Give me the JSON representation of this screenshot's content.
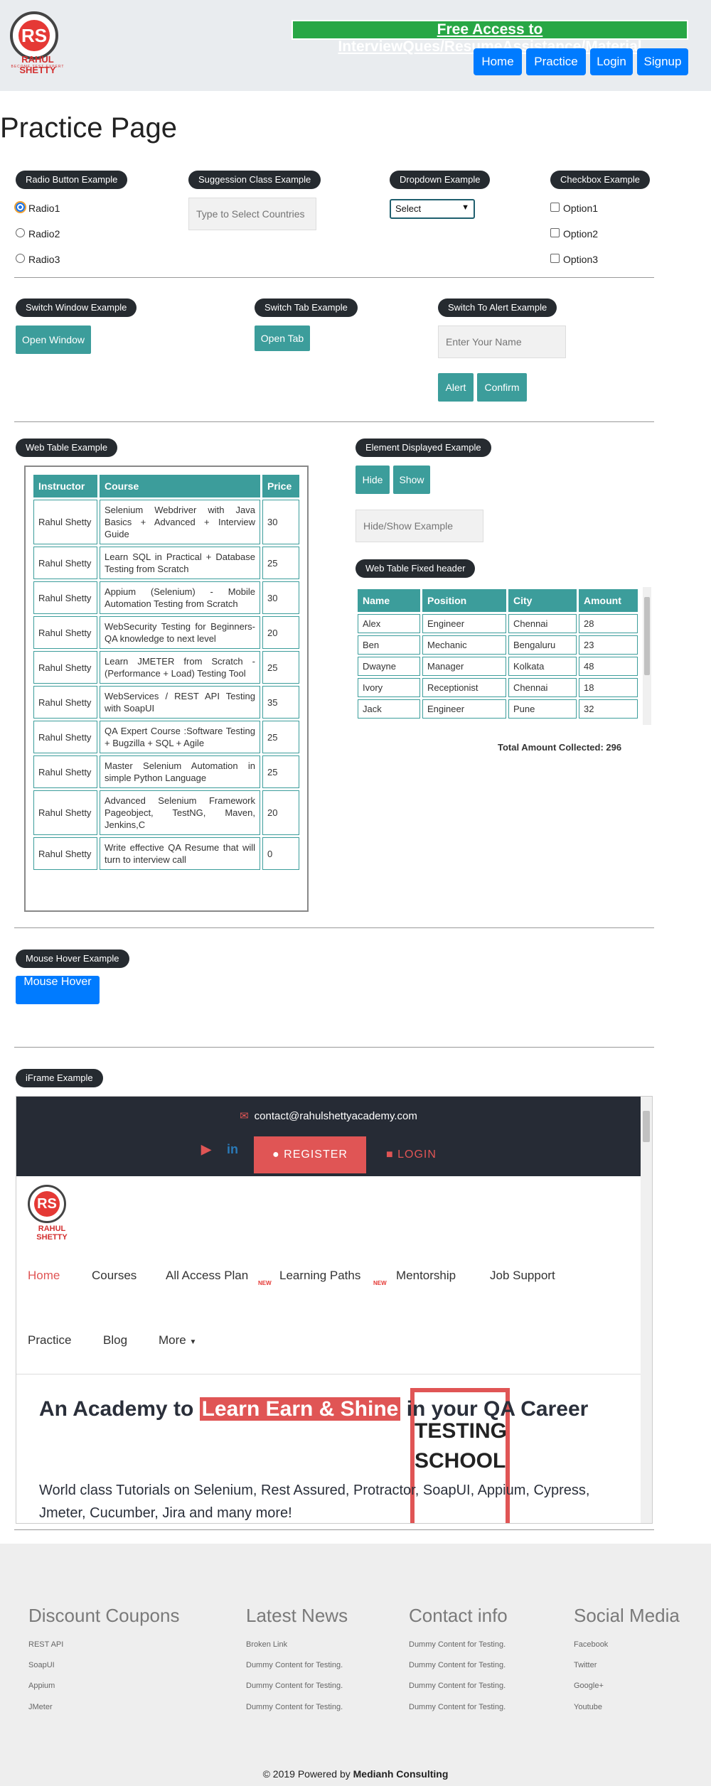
{
  "brand": {
    "name": "RAHUL SHETTY",
    "tagline": "BECOME TEST EXPERT",
    "logo_letters": "RS"
  },
  "header": {
    "free_access_link": "Free Access to InterviewQues/ResumeAssistance/Material",
    "nav": [
      "Home",
      "Practice",
      "Login",
      "Signup"
    ]
  },
  "page_title": "Practice Page",
  "radio_section": {
    "title": "Radio Button Example",
    "options": [
      "Radio1",
      "Radio2",
      "Radio3"
    ],
    "selected": "Radio1"
  },
  "suggestion_section": {
    "title": "Suggession Class Example",
    "placeholder": "Type to Select Countries"
  },
  "dropdown_section": {
    "title": "Dropdown Example",
    "selected": "Select"
  },
  "checkbox_section": {
    "title": "Checkbox Example",
    "options": [
      "Option1",
      "Option2",
      "Option3"
    ]
  },
  "switch_window": {
    "title": "Switch Window Example",
    "button": "Open Window"
  },
  "switch_tab": {
    "title": "Switch Tab Example",
    "button": "Open Tab"
  },
  "alert_section": {
    "title": "Switch To Alert Example",
    "placeholder": "Enter Your Name",
    "alert_button": "Alert",
    "confirm_button": "Confirm"
  },
  "web_table": {
    "title": "Web Table Example",
    "headers": [
      "Instructor",
      "Course",
      "Price"
    ],
    "rows": [
      [
        "Rahul Shetty",
        "Selenium Webdriver with Java Basics + Advanced + Interview Guide",
        "30"
      ],
      [
        "Rahul Shetty",
        "Learn SQL in Practical + Database Testing from Scratch",
        "25"
      ],
      [
        "Rahul Shetty",
        "Appium (Selenium) - Mobile Automation Testing from Scratch",
        "30"
      ],
      [
        "Rahul Shetty",
        "WebSecurity Testing for Beginners-QA knowledge to next level",
        "20"
      ],
      [
        "Rahul Shetty",
        "Learn JMETER from Scratch - (Performance + Load) Testing Tool",
        "25"
      ],
      [
        "Rahul Shetty",
        "WebServices / REST API Testing with SoapUI",
        "35"
      ],
      [
        "Rahul Shetty",
        "QA Expert Course :Software Testing + Bugzilla + SQL + Agile",
        "25"
      ],
      [
        "Rahul Shetty",
        "Master Selenium Automation in simple Python Language",
        "25"
      ],
      [
        "Rahul Shetty",
        "Advanced Selenium Framework Pageobject, TestNG, Maven, Jenkins,C",
        "20"
      ],
      [
        "Rahul Shetty",
        "Write effective QA Resume that will turn to interview call",
        "0"
      ]
    ]
  },
  "element_displayed": {
    "title": "Element Displayed Example",
    "hide_button": "Hide",
    "show_button": "Show",
    "placeholder": "Hide/Show Example"
  },
  "fixed_table": {
    "title": "Web Table Fixed header",
    "headers": [
      "Name",
      "Position",
      "City",
      "Amount"
    ],
    "rows": [
      [
        "Alex",
        "Engineer",
        "Chennai",
        "28"
      ],
      [
        "Ben",
        "Mechanic",
        "Bengaluru",
        "23"
      ],
      [
        "Dwayne",
        "Manager",
        "Kolkata",
        "48"
      ],
      [
        "Ivory",
        "Receptionist",
        "Chennai",
        "18"
      ],
      [
        "Jack",
        "Engineer",
        "Pune",
        "32"
      ]
    ],
    "total_label": "Total Amount Collected:",
    "total_value": "296"
  },
  "mouse_hover": {
    "title": "Mouse Hover Example",
    "button": "Mouse Hover"
  },
  "iframe": {
    "title": "iFrame Example",
    "email": "contact@rahulshettyacademy.com",
    "register": "REGISTER",
    "login": "LOGIN",
    "nav": [
      "Home",
      "Courses",
      "All Access Plan",
      "Learning Paths",
      "Mentorship",
      "Job Support",
      "Practice",
      "Blog",
      "More"
    ],
    "new_badge": "NEW",
    "hero_prefix": "An Academy to",
    "hero_highlight": "Learn Earn & Shine",
    "hero_suffix": "in your QA Career",
    "hero_sub": "World class Tutorials on Selenium, Rest Assured, Protractor, SoapUI, Appium, Cypress, Jmeter, Cucumber, Jira and many more!",
    "image_text": "TESTING SCHOOL"
  },
  "footer": {
    "columns": [
      {
        "title": "Discount Coupons",
        "items": [
          "REST API",
          "SoapUI",
          "Appium",
          "JMeter"
        ]
      },
      {
        "title": "Latest News",
        "items": [
          "Broken Link",
          "Dummy Content for Testing.",
          "Dummy Content for Testing.",
          "Dummy Content for Testing."
        ]
      },
      {
        "title": "Contact info",
        "items": [
          "Dummy Content for Testing.",
          "Dummy Content for Testing.",
          "Dummy Content for Testing.",
          "Dummy Content for Testing."
        ]
      },
      {
        "title": "Social Media",
        "items": [
          "Facebook",
          "Twitter",
          "Google+",
          "Youtube"
        ]
      }
    ],
    "copyright": "© 2019 Powered by",
    "company": "Medianh Consulting"
  },
  "colors": {
    "primary": "#007bff",
    "teal": "#3c9d9b",
    "dark_pill": "#262b30",
    "green": "#28a745",
    "brand_red": "#e53935"
  }
}
